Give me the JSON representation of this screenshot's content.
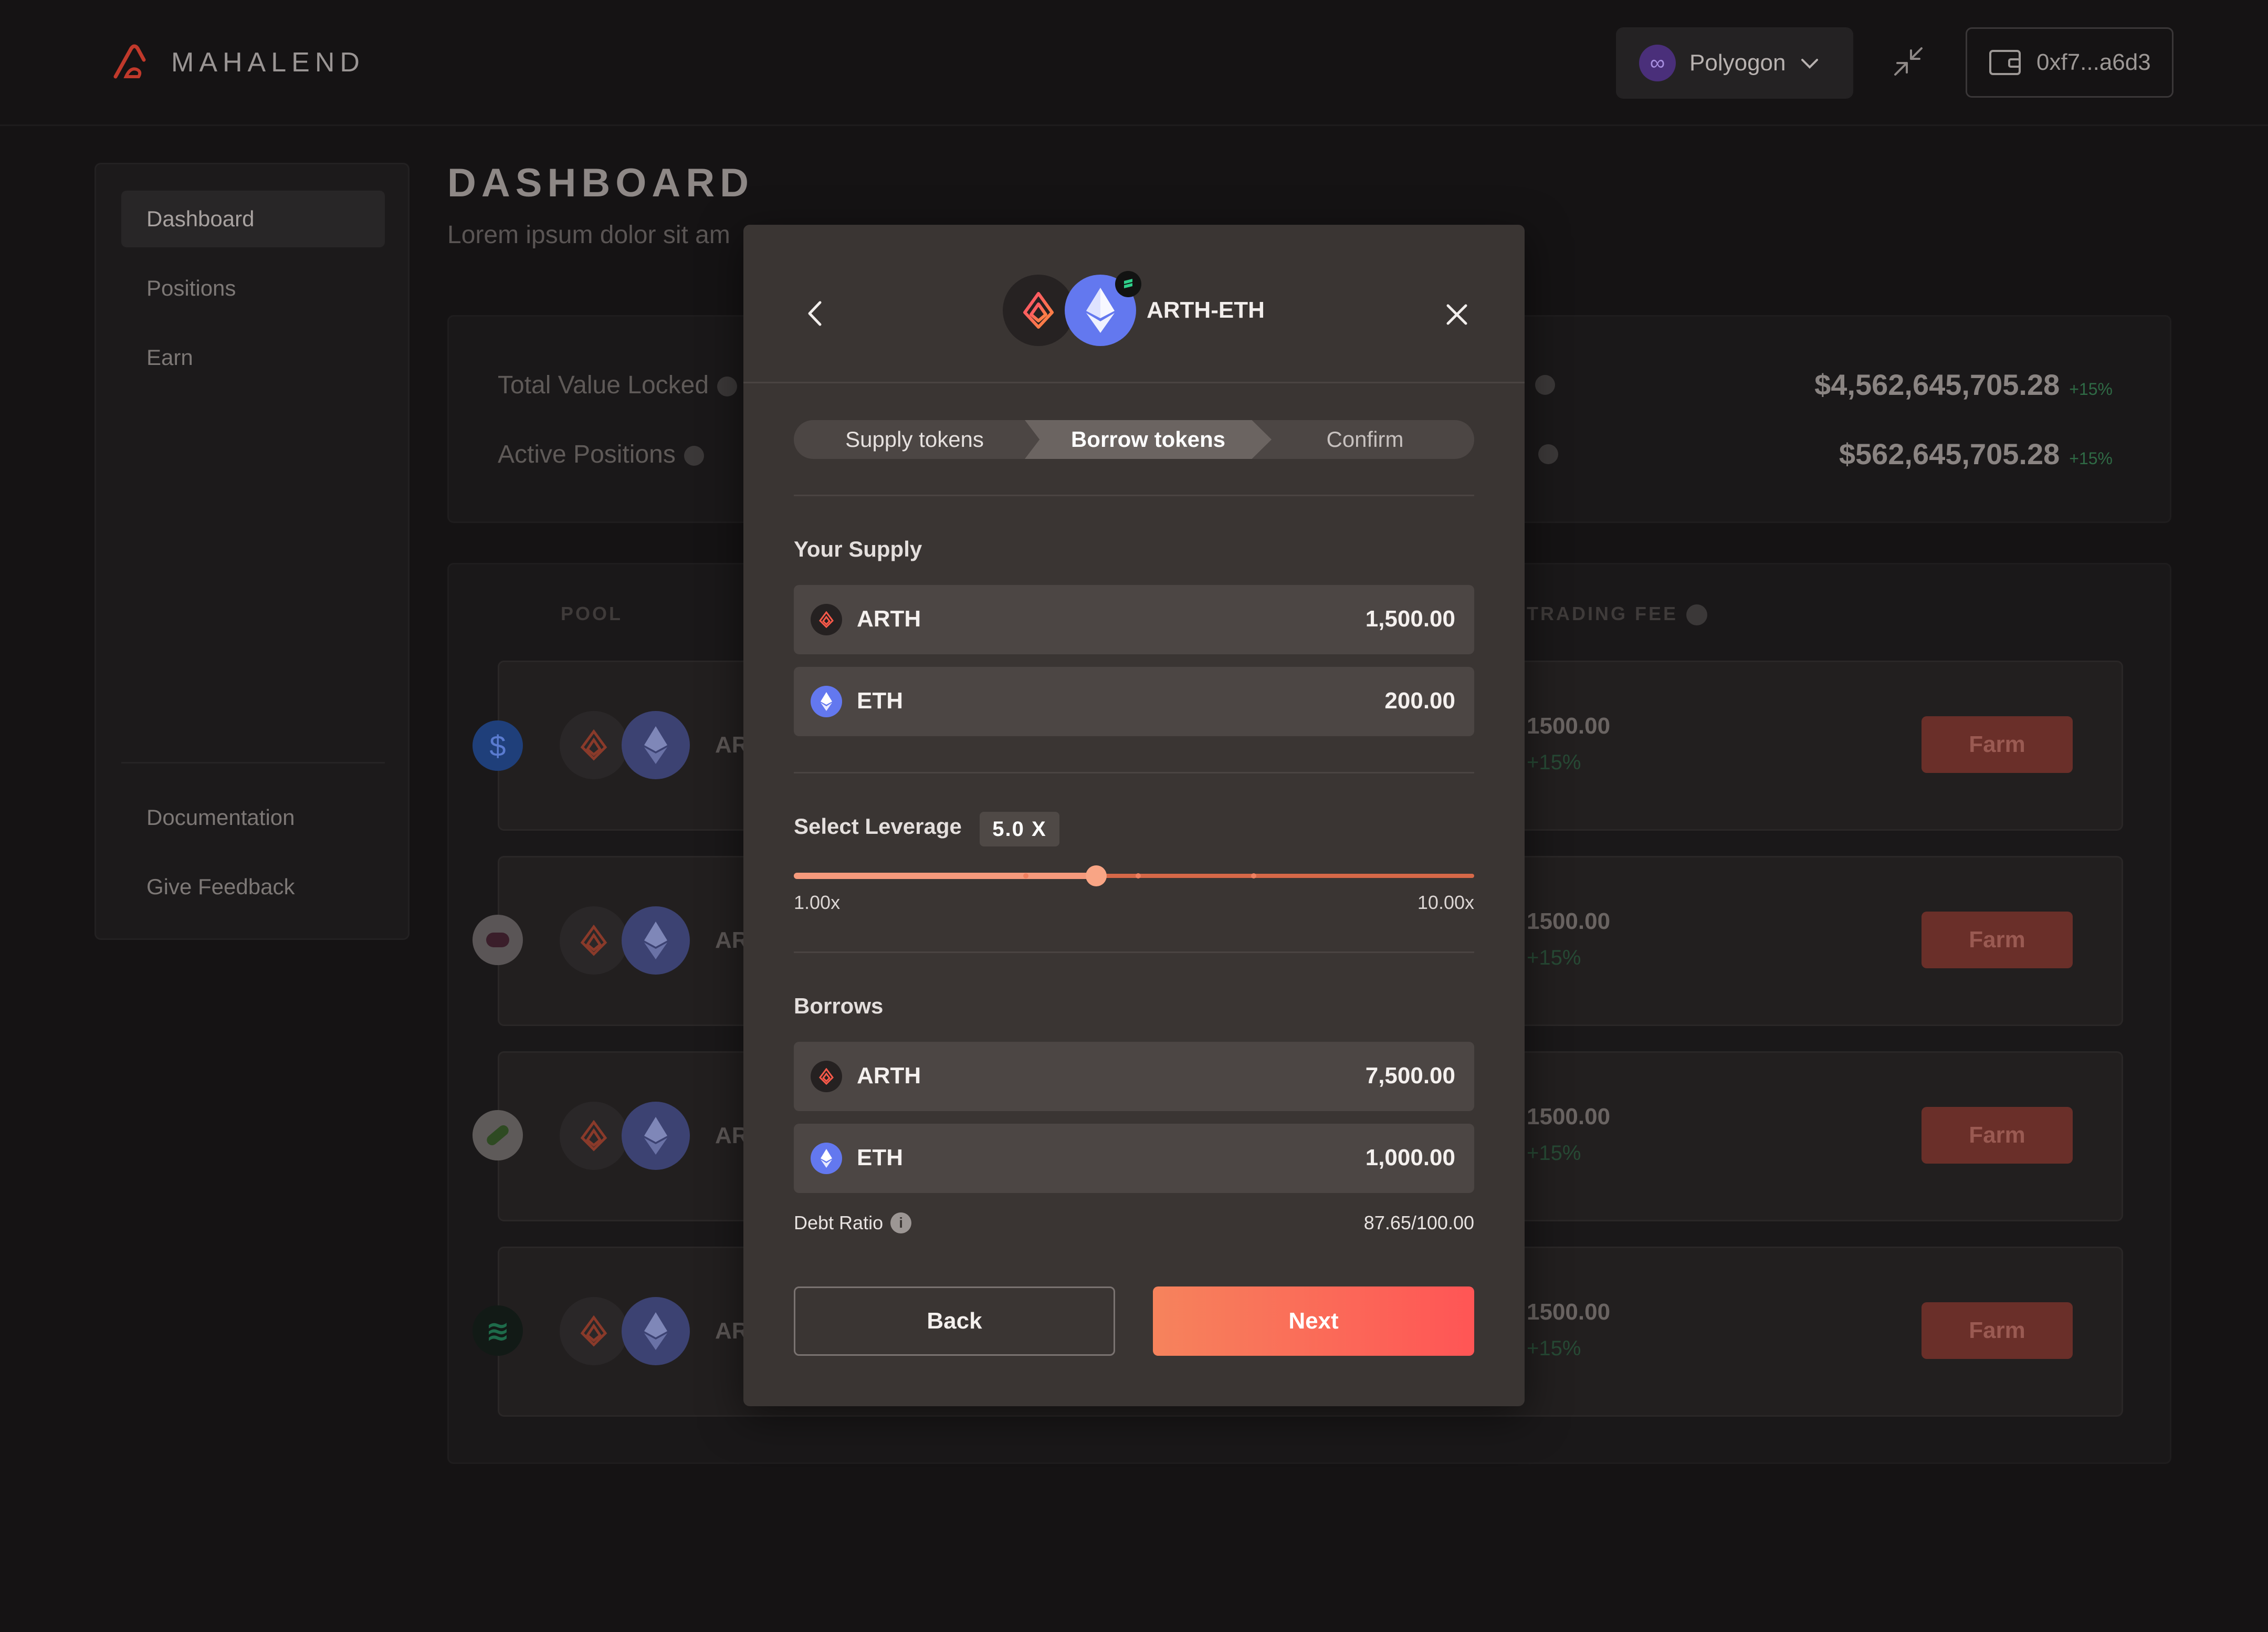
{
  "app": {
    "brand": "MAHALEND"
  },
  "header": {
    "network_label": "Polyogon",
    "wallet_label": "0xf7...a6d3"
  },
  "sidebar": {
    "items": [
      {
        "label": "Dashboard"
      },
      {
        "label": "Positions"
      },
      {
        "label": "Earn"
      }
    ],
    "footer_items": [
      {
        "label": "Documentation"
      },
      {
        "label": "Give Feedback"
      }
    ]
  },
  "page": {
    "title": "DASHBOARD",
    "subtitle": "Lorem ipsum dolor sit am"
  },
  "stats": {
    "tvl_label": "Total Value Locked",
    "active_label": "Active Positions",
    "right_value_1": "$4,562,645,705.28",
    "right_delta_1": "+15%",
    "right_value_2": "$562,645,705.28",
    "right_delta_2": "+15%"
  },
  "pools": {
    "col_pool": "POOL",
    "col_trading_fee": "TRADING FEE",
    "rows": [
      {
        "pair": "AR",
        "value": "1500.00",
        "delta": "+15%",
        "button": "Farm"
      },
      {
        "pair": "AR",
        "value": "1500.00",
        "delta": "+15%",
        "button": "Farm"
      },
      {
        "pair": "AR",
        "value": "1500.00",
        "delta": "+15%",
        "button": "Farm"
      },
      {
        "pair": "AR",
        "value": "1500.00",
        "delta": "+15%",
        "button": "Farm"
      }
    ]
  },
  "modal": {
    "title": "ARTH-ETH",
    "steps": [
      {
        "label": "Supply tokens"
      },
      {
        "label": "Borrow tokens"
      },
      {
        "label": "Confirm"
      }
    ],
    "current_step": 2,
    "supply": {
      "label": "Your Supply",
      "tokens": [
        {
          "symbol": "ARTH",
          "amount": "1,500.00"
        },
        {
          "symbol": "ETH",
          "amount": "200.00"
        }
      ]
    },
    "leverage": {
      "label": "Select Leverage",
      "badge": "5.0 X",
      "value": 5.0,
      "min_label": "1.00x",
      "max_label": "10.00x"
    },
    "borrows": {
      "label": "Borrows",
      "tokens": [
        {
          "symbol": "ARTH",
          "amount": "7,500.00"
        },
        {
          "symbol": "ETH",
          "amount": "1,000.00"
        }
      ]
    },
    "debt_ratio": {
      "label": "Debt Ratio",
      "info": "i",
      "value": "87.65/100.00"
    },
    "buttons": {
      "back": "Back",
      "next": "Next"
    }
  },
  "icons": {
    "arth": "arth-logo-icon",
    "eth": "eth-diamond-icon",
    "network": "polygon-icon",
    "wallet": "wallet-icon"
  },
  "colors": {
    "accent": "#ff6a55",
    "positive": "#2f6a45",
    "eth": "#6378ef"
  }
}
